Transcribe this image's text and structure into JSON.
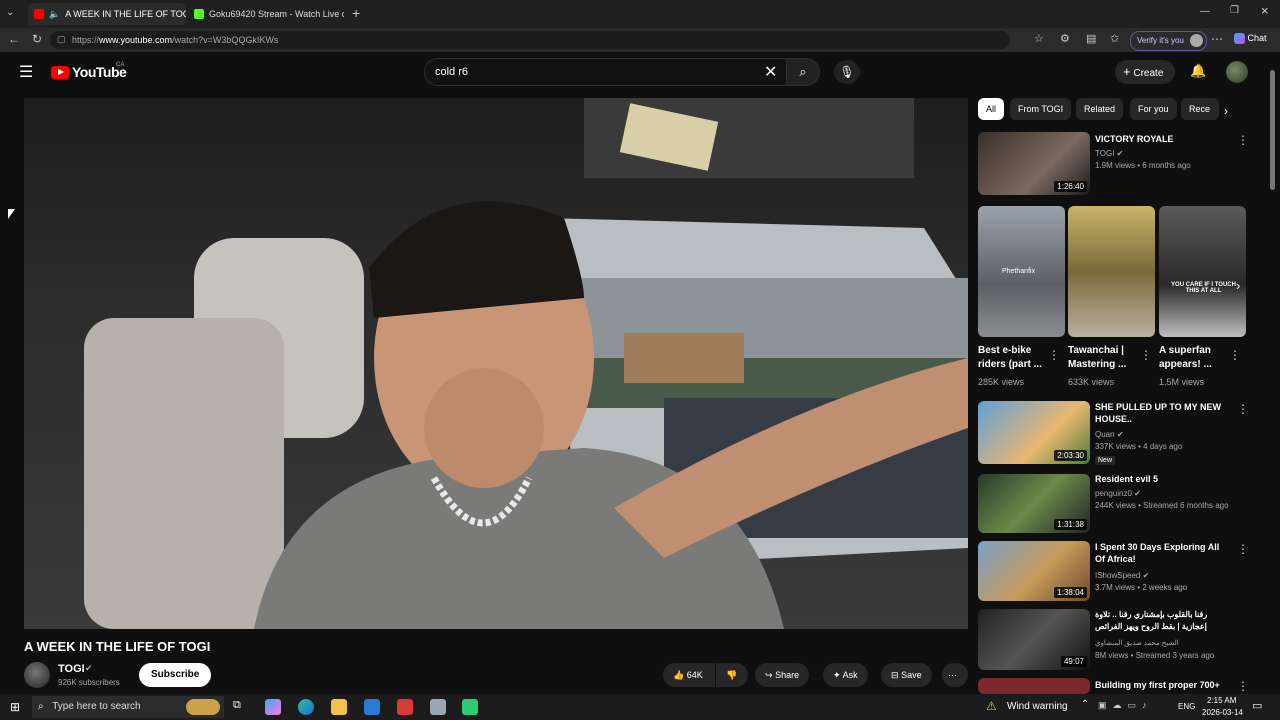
{
  "browser": {
    "tabs": [
      {
        "title": "A WEEK IN THE LIFE OF TOGI"
      },
      {
        "title": "Goku69420 Stream - Watch Live o"
      }
    ],
    "url_prefix": "https://",
    "url_host": "www.youtube.com",
    "url_path": "/watch?v=W3bQQGkIKWs",
    "verify_label": "Verify it's you",
    "chat_label": "Chat"
  },
  "youtube": {
    "logo_text": "YouTube",
    "country": "CA",
    "search_value": "cold r6",
    "create_label": "Create"
  },
  "video": {
    "title": "A WEEK IN THE LIFE OF TOGI",
    "channel": "TOGI",
    "subscribers": "926K subscribers",
    "subscribe_label": "Subscribe",
    "likes": "64K",
    "share_label": "Share",
    "ask_label": "Ask",
    "save_label": "Save"
  },
  "filters": [
    "All",
    "From TOGI",
    "Related",
    "For you",
    "Rece"
  ],
  "recs": [
    {
      "title": "VICTORY ROYALE",
      "channel": "TOGI",
      "meta": "1.9M views • 6 months ago",
      "duration": "1:26:40"
    },
    {
      "title": "SHE PULLED UP TO MY NEW HOUSE..",
      "channel": "Quan",
      "meta": "337K views • 4 days ago",
      "duration": "2:03:30",
      "badge": "New"
    },
    {
      "title": "Resident evil 5",
      "channel": "penguinz0",
      "meta": "244K views • Streamed 6 months ago",
      "duration": "1:31:38"
    },
    {
      "title": "I Spent 30 Days Exploring All Of Africa!",
      "channel": "IShowSpeed",
      "meta": "3.7M views • 2 weeks ago",
      "duration": "1:38:04"
    },
    {
      "title": "رقنا بالقلوب بإمشتاري رقنا .. تلاوة إعجازية | بقط الروح ويهز الفرائص للشيخ المشتاري",
      "channel": "الشيخ محمد صديق المنشاوي",
      "meta": "8M views • Streamed 3 years ago",
      "duration": "49:07"
    },
    {
      "title": "Building my first proper 700+",
      "channel": "",
      "meta": "",
      "duration": ""
    }
  ],
  "shorts": [
    {
      "title": "Best e-bike riders (part ...",
      "views": "285K views",
      "overlay": "Phethanfix"
    },
    {
      "title": "Tawanchai | Mastering ...",
      "views": "633K views",
      "overlay": ""
    },
    {
      "title": "A superfan appears! ...",
      "views": "1.5M views",
      "overlay": "YOU CARE IF I TOUCH THIS AT ALL"
    }
  ],
  "taskbar": {
    "search_placeholder": "Type here to search",
    "weather": "Wind warning",
    "lang": "ENG",
    "time": "2:15 AM",
    "date": "2026-03-14"
  },
  "colors": {
    "youtube_red": "#ff0000",
    "accent_blue": "#3ea6ff"
  }
}
